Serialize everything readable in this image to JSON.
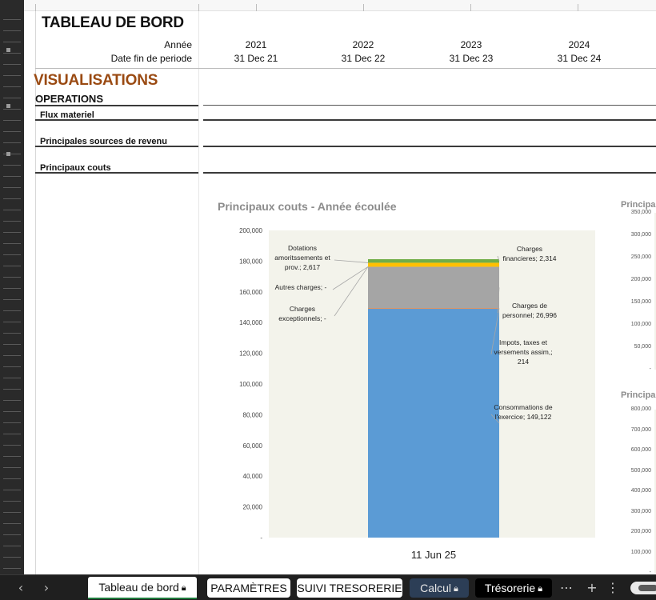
{
  "header": {
    "title": "TABLEAU DE BORD",
    "year_label": "Année",
    "period_end_label": "Date fin de periode",
    "years": [
      "2021",
      "2022",
      "2023",
      "2024"
    ],
    "period_ends": [
      "31 Dec 21",
      "31 Dec 22",
      "31 Dec 23",
      "31 Dec 24"
    ]
  },
  "sections": {
    "visualisations": "VISUALISATIONS",
    "operations": "OPERATIONS",
    "flux": "Flux materiel",
    "revenue": "Principales sources de revenu",
    "costs": "Principaux couts"
  },
  "chart_data": [
    {
      "type": "bar",
      "stacked": true,
      "title": "Principaux couts - Année écoulée",
      "categories": [
        "11 Jun 25"
      ],
      "ylim": [
        0,
        200000
      ],
      "yticks": [
        "-",
        "20,000",
        "40,000",
        "60,000",
        "80,000",
        "100,000",
        "120,000",
        "140,000",
        "160,000",
        "180,000",
        "200,000"
      ],
      "grid": false,
      "plot_background": "#f3f3eb",
      "series": [
        {
          "name": "Consommations de l'exercice",
          "values": [
            149122
          ],
          "color": "#5b9bd5",
          "label": "Consommations de l'exercice; 149,122"
        },
        {
          "name": "Impots, taxes et versements assim,",
          "values": [
            214
          ],
          "color": "#ed7d31",
          "label": "Impots, taxes et versements assim,; 214"
        },
        {
          "name": "Charges de personnel",
          "values": [
            26996
          ],
          "color": "#a5a5a5",
          "label": "Charges de personnel; 26,996"
        },
        {
          "name": "Charges exceptionnels",
          "values": [
            0
          ],
          "color": "#4472c4",
          "label": "Charges exceptionnels; -"
        },
        {
          "name": "Autres charges",
          "values": [
            0
          ],
          "color": "#ffc000",
          "label": "Autres charges; -"
        },
        {
          "name": "Dotations amoritssements et prov.",
          "values": [
            2617
          ],
          "color": "#ffc000",
          "label": "Dotations amoritssements et prov.; 2,617"
        },
        {
          "name": "Charges financieres",
          "values": [
            2314
          ],
          "color": "#70ad47",
          "label": "Charges financieres; 2,314"
        }
      ]
    },
    {
      "type": "bar",
      "title": "Principa",
      "ylim": [
        0,
        350000
      ],
      "yticks": [
        "-",
        "50,000",
        "100,000",
        "150,000",
        "200,000",
        "250,000",
        "300,000",
        "350,000"
      ]
    },
    {
      "type": "bar",
      "title": "Principa",
      "ylim": [
        0,
        800000
      ],
      "yticks": [
        "-",
        "100,000",
        "200,000",
        "300,000",
        "400,000",
        "500,000",
        "600,000",
        "700,000",
        "800,000"
      ]
    }
  ],
  "tabs": [
    {
      "label": "Tableau de bord",
      "locked": true,
      "style": "active"
    },
    {
      "label": "PARAMÈTRES",
      "locked": false,
      "style": "light"
    },
    {
      "label": "SUIVI TRESORERIE",
      "locked": false,
      "style": "light"
    },
    {
      "label": "Calcul",
      "locked": true,
      "style": "blue"
    },
    {
      "label": "Trésorerie",
      "locked": true,
      "style": "dark"
    }
  ],
  "icons": {
    "prev": "chevron-left-icon",
    "next": "chevron-right-icon",
    "more": "more-icon",
    "add": "add-sheet-icon",
    "options": "vertical-dots-icon",
    "lock": "lock-icon"
  }
}
